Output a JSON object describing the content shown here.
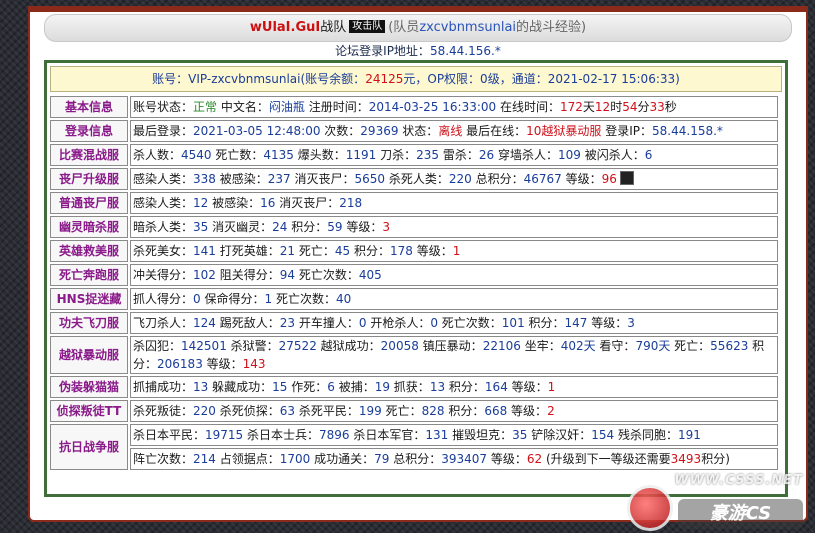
{
  "header": {
    "team_name": "wUlaI.GuI",
    "team_suffix": "战队",
    "badge": "攻击队",
    "member_prefix": "(队员",
    "member_name": "zxcvbnmsunlai",
    "member_suffix": "的战斗经验)"
  },
  "ip_line": {
    "label": "论坛登录IP地址：",
    "value": "58.44.156.*"
  },
  "account": {
    "p1": "账号：VIP-zxcvbnmsunlai(账号余额：",
    "balance": "24125",
    "p2": "元，OP权限：0级，通道：2021-02-17 15:06:33)"
  },
  "rows": {
    "basic": {
      "label": "基本信息",
      "status_label": "账号状态：",
      "status": "正常",
      "cn_label": " 中文名：",
      "cn_name": "闷油瓶",
      "reg_label": " 注册时间：",
      "reg_time": "2014-03-25 16:33:00",
      "online_label": " 在线时间：",
      "days": "172",
      "days_unit": "天",
      "hours": "12",
      "hours_unit": "时",
      "minutes": "54",
      "minutes_unit": "分",
      "seconds": "33",
      "seconds_unit": "秒"
    },
    "login": {
      "label": "登录信息",
      "last_label": "最后登录：",
      "last": "2021-03-05 12:48:00",
      "count_label": " 次数：",
      "count": "29369",
      "state_label": " 状态：",
      "state": "离线",
      "last_online_label": " 最后在线：",
      "last_online": "10越狱暴动服",
      "ip_label": " 登录IP：",
      "ip": "58.44.158.*"
    },
    "match": {
      "label": "比赛混战服",
      "items": [
        {
          "k": "杀人数：",
          "v": "4540"
        },
        {
          "k": " 死亡数：",
          "v": "4135"
        },
        {
          "k": " 爆头数：",
          "v": "1191"
        },
        {
          "k": " 刀杀：",
          "v": "235"
        },
        {
          "k": " 雷杀：",
          "v": "26"
        },
        {
          "k": " 穿墙杀人：",
          "v": "109"
        },
        {
          "k": " 被闪杀人：",
          "v": "6"
        }
      ]
    },
    "zombie_up": {
      "label": "丧尸升级服",
      "items": [
        {
          "k": "感染人类：",
          "v": "338"
        },
        {
          "k": " 被感染：",
          "v": "237"
        },
        {
          "k": " 消灭丧尸：",
          "v": "5650"
        },
        {
          "k": " 杀死人类：",
          "v": "220"
        },
        {
          "k": " 总积分：",
          "v": "46767"
        }
      ],
      "level_label": " 等级：",
      "level": "96",
      "rank_icon": "rank-icon"
    },
    "zombie": {
      "label": "普通丧尸服",
      "items": [
        {
          "k": "感染人类：",
          "v": "12"
        },
        {
          "k": " 被感染：",
          "v": "16"
        },
        {
          "k": " 消灭丧尸：",
          "v": "218"
        }
      ]
    },
    "ghost": {
      "label": "幽灵暗杀服",
      "items": [
        {
          "k": "暗杀人类：",
          "v": "35"
        },
        {
          "k": " 消灭幽灵：",
          "v": "24"
        },
        {
          "k": " 积分：",
          "v": "59"
        }
      ],
      "level_label": " 等级：",
      "level": "3"
    },
    "hero": {
      "label": "英雄救美服",
      "items": [
        {
          "k": "杀死美女：",
          "v": "141"
        },
        {
          "k": " 打死英雄：",
          "v": "21"
        },
        {
          "k": " 死亡：",
          "v": "45"
        },
        {
          "k": " 积分：",
          "v": "178"
        }
      ],
      "level_label": " 等级：",
      "level": "1"
    },
    "run": {
      "label": "死亡奔跑服",
      "items": [
        {
          "k": "冲关得分：",
          "v": "102"
        },
        {
          "k": " 阻关得分：",
          "v": "94"
        },
        {
          "k": " 死亡次数：",
          "v": "405"
        }
      ]
    },
    "hns": {
      "label": "HNS捉迷藏",
      "items": [
        {
          "k": "抓人得分：",
          "v": "0"
        },
        {
          "k": " 保命得分：",
          "v": "1"
        },
        {
          "k": " 死亡次数：",
          "v": "40"
        }
      ]
    },
    "kungfu": {
      "label": "功夫飞刀服",
      "items": [
        {
          "k": "飞刀杀人：",
          "v": "124"
        },
        {
          "k": " 踢死敌人：",
          "v": "23"
        },
        {
          "k": " 开车撞人：",
          "v": "0"
        },
        {
          "k": " 开枪杀人：",
          "v": "0"
        },
        {
          "k": " 死亡次数：",
          "v": "101"
        },
        {
          "k": " 积分：",
          "v": "147"
        },
        {
          "k": " 等级：",
          "v": "3"
        }
      ]
    },
    "jail": {
      "label": "越狱暴动服",
      "items": [
        {
          "k": "杀囚犯：",
          "v": "142501"
        },
        {
          "k": " 杀狱警：",
          "v": "27522"
        },
        {
          "k": " 越狱成功：",
          "v": "20058"
        },
        {
          "k": " 镇压暴动：",
          "v": "22106"
        },
        {
          "k": " 坐牢：",
          "v": "402天"
        },
        {
          "k": " 看守：",
          "v": "790天"
        },
        {
          "k": " 死亡：",
          "v": "55623"
        },
        {
          "k": " 积分：",
          "v": "206183"
        }
      ],
      "level_label": " 等级：",
      "level": "143"
    },
    "cat": {
      "label": "伪装躲猫猫",
      "items": [
        {
          "k": "抓捕成功：",
          "v": "13"
        },
        {
          "k": " 躲藏成功：",
          "v": "15"
        },
        {
          "k": " 作死：",
          "v": "6"
        },
        {
          "k": " 被捕：",
          "v": "19"
        },
        {
          "k": " 抓获：",
          "v": "13"
        },
        {
          "k": " 积分：",
          "v": "164"
        }
      ],
      "level_label": " 等级：",
      "level": "1"
    },
    "traitor": {
      "label": "侦探叛徒TT",
      "items": [
        {
          "k": "杀死叛徒：",
          "v": "220"
        },
        {
          "k": " 杀死侦探：",
          "v": "63"
        },
        {
          "k": " 杀死平民：",
          "v": "199"
        },
        {
          "k": " 死亡：",
          "v": "828"
        },
        {
          "k": " 积分：",
          "v": "668"
        }
      ],
      "level_label": " 等级：",
      "level": "2"
    },
    "war": {
      "label": "抗日战争服",
      "items1": [
        {
          "k": "杀日本平民：",
          "v": "19715"
        },
        {
          "k": " 杀日本士兵：",
          "v": "7896"
        },
        {
          "k": " 杀日本军官：",
          "v": "131"
        },
        {
          "k": " 摧毁坦克：",
          "v": "35"
        },
        {
          "k": " 铲除汉奸：",
          "v": "154"
        },
        {
          "k": " 残杀同胞：",
          "v": "191"
        }
      ],
      "items2": [
        {
          "k": "阵亡次数：",
          "v": "214"
        },
        {
          "k": " 占领据点：",
          "v": "1700"
        },
        {
          "k": " 成功通关：",
          "v": "79"
        },
        {
          "k": " 总积分：",
          "v": "393407"
        }
      ],
      "level_label": " 等级：",
      "level": "62",
      "upgrade_p1": " (升级到下一等级还需要",
      "upgrade_need": "3493",
      "upgrade_p2": "积分)"
    }
  },
  "watermark": {
    "line1": "WWW.CSSS.NET",
    "line2": "豪游CS"
  },
  "colors": {
    "label": "#8a1a8a",
    "value_blue": "#1a3d9a",
    "red": "#d0101a",
    "green": "#2a8a2a",
    "frame": "#3f6e3a"
  }
}
